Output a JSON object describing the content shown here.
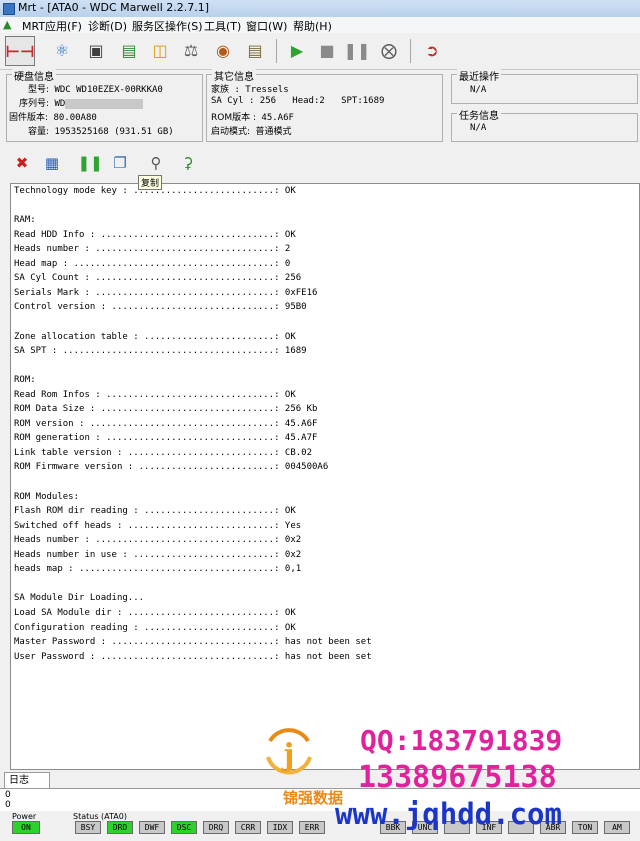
{
  "window": {
    "title": "Mrt - [ATA0 - WDC Marwell 2.2.7.1]"
  },
  "menu": [
    {
      "label": "MRT应用(F)"
    },
    {
      "label": "诊断(D)"
    },
    {
      "label": "服务区操作(S)"
    },
    {
      "label": "工具(T)"
    },
    {
      "label": "窗口(W)"
    },
    {
      "label": "帮助(H)"
    }
  ],
  "disk_info": {
    "title": "硬盘信息",
    "model_label": "型号:",
    "model": "WDC WD10EZEX-00RKKA0",
    "serial_label": "序列号:",
    "serial_prefix": "WD",
    "firmware_label": "固件版本:",
    "firmware": "80.00A80",
    "capacity_label": "容量:",
    "capacity": "1953525168 (931.51 GB)"
  },
  "other_info": {
    "title": "其它信息",
    "family_label": "家族",
    "family": ": Tressels",
    "sacyl_label": "SA Cyl",
    "sacyl": ": 256",
    "head_label": "Head:",
    "head": "2",
    "spt_label": "SPT:",
    "spt": "1689",
    "rom_label": "ROM版本 :",
    "rom": "45.A6F",
    "boot_label": "启动模式:",
    "boot": "普通模式"
  },
  "recent_op": {
    "title": "最近操作",
    "value": "N/A"
  },
  "task_info": {
    "title": "任务信息",
    "value": "N/A"
  },
  "tooltip": "复制",
  "output_lines": [
    "Technology mode key : ..........................: OK",
    "",
    "RAM:",
    "Read HDD Info : ................................: OK",
    "Heads number : .................................: 2",
    "Head map : .....................................: 0",
    "SA Cyl Count : .................................: 256",
    "Serials Mark : .................................: 0xFE16",
    "Control version : ..............................: 95B0",
    "",
    "Zone allocation table : ........................: OK",
    "SA SPT : .......................................: 1689",
    "",
    "ROM:",
    "Read Rom Infos : ...............................: OK",
    "ROM Data Size : ................................: 256 Kb",
    "ROM version : ..................................: 45.A6F",
    "ROM generation : ...............................: 45.A7F",
    "Link table version : ...........................: CB.02",
    "ROM Firmware version : .........................: 004500A6",
    "",
    "ROM Modules:",
    "Flash ROM dir reading : ........................: OK",
    "Switched off heads : ...........................: Yes",
    "Heads number : .................................: 0x2",
    "Heads number in use : ..........................: 0x2",
    "heads map : ....................................: 0,1",
    "",
    "SA Module Dir Loading...",
    "Load SA Module dir : ...........................: OK",
    "Configuration reading : ........................: OK",
    "Master Password : ..............................: has not been set",
    "User Password : ................................: has not been set"
  ],
  "log": {
    "tab": "日志",
    "lines": [
      "0",
      "0"
    ]
  },
  "status": {
    "power_label": "Power",
    "power": "ON",
    "ata_label": "Status (ATA0)",
    "flags": [
      "BSY",
      "DRD",
      "DWF",
      "DSC",
      "DRQ",
      "CRR",
      "IDX",
      "ERR"
    ],
    "flags_on": [
      "DRD",
      "DSC"
    ],
    "err_flags": [
      "BBK",
      "UNC",
      "",
      "INF",
      "",
      "ABR",
      "TON",
      "AM"
    ]
  },
  "watermark": {
    "qq": "QQ:183791839",
    "phone": "13389675138",
    "url": "www.jqhdd.com",
    "brand": "锦强数据",
    "logo_letter": "j"
  },
  "colors": {
    "indicator_on": "#2cd12c",
    "watermark_pink": "#e0239d",
    "watermark_blue": "#1b35c9",
    "brand_orange": "#e98a17"
  }
}
